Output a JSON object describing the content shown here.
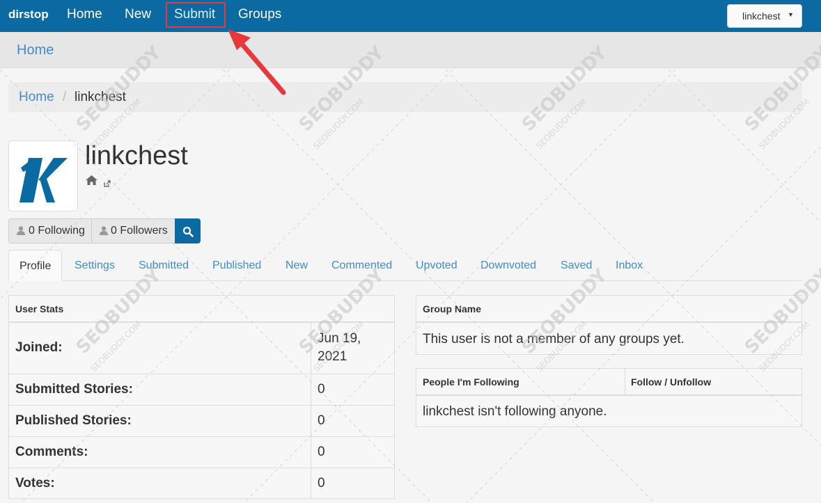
{
  "navbar": {
    "brand": "dirstop",
    "links": [
      "Home",
      "New",
      "Submit",
      "Groups"
    ],
    "user_menu": "linkchest"
  },
  "subheader": {
    "title": "Home"
  },
  "breadcrumb": {
    "home": "Home",
    "separator": "/",
    "current": "linkchest"
  },
  "profile": {
    "name": "linkchest",
    "avatar_letter": "K",
    "following_btn": "0 Following",
    "followers_btn": "0 Followers"
  },
  "tabs": [
    "Profile",
    "Settings",
    "Submitted",
    "Published",
    "New",
    "Commented",
    "Upvoted",
    "Downvoted",
    "Saved",
    "Inbox"
  ],
  "user_stats": {
    "heading": "User Stats",
    "rows": [
      {
        "label": "Joined:",
        "value": "Jun 19, 2021"
      },
      {
        "label": "Submitted Stories:",
        "value": "0"
      },
      {
        "label": "Published Stories:",
        "value": "0"
      },
      {
        "label": "Comments:",
        "value": "0"
      },
      {
        "label": "Votes:",
        "value": "0"
      }
    ]
  },
  "groups": {
    "heading": "Group Name",
    "empty_text": "This user is not a member of any groups yet."
  },
  "following": {
    "col1": "People I'm Following",
    "col2": "Follow / Unfollow",
    "empty_text": "linkchest isn't following anyone."
  },
  "watermark": {
    "brand": "SEOBUDDY",
    "domain": "SEOBUDDY.COM"
  },
  "colors": {
    "navbar": "#0a6aa1",
    "link": "#428bca",
    "highlight": "#e8383d",
    "logo": "#0a6aa1"
  }
}
